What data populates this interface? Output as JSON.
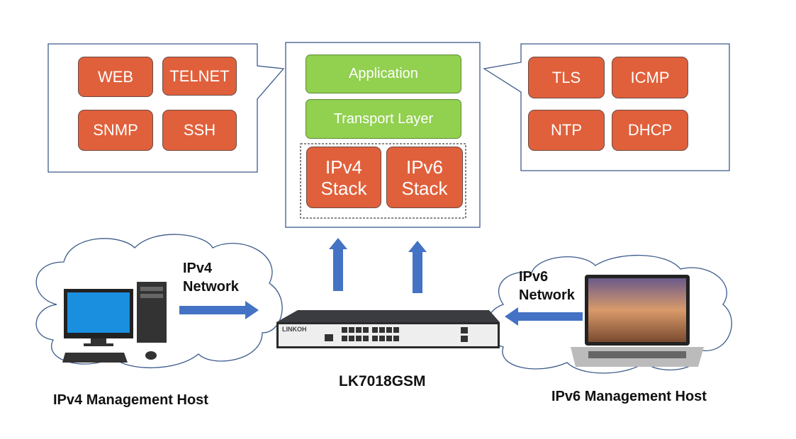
{
  "left_callout": {
    "items": [
      "WEB",
      "TELNET",
      "SNMP",
      "SSH"
    ]
  },
  "stack": {
    "application": "Application",
    "transport": "Transport Layer",
    "ipv4": "IPv4\nStack",
    "ipv6": "IPv6\nStack"
  },
  "right_callout": {
    "items": [
      "TLS",
      "ICMP",
      "NTP",
      "DHCP"
    ]
  },
  "ipv4_network": "IPv4\nNetwork",
  "ipv6_network": "IPv6\nNetwork",
  "switch": {
    "model": "LK7018GSM",
    "brand_logo": "LINKOH"
  },
  "ipv4_host": "IPv4 Management Host",
  "ipv6_host": "IPv6 Management Host",
  "colors": {
    "protocol": "#E0603B",
    "layer": "#92D050",
    "arrow": "#4472C4"
  }
}
